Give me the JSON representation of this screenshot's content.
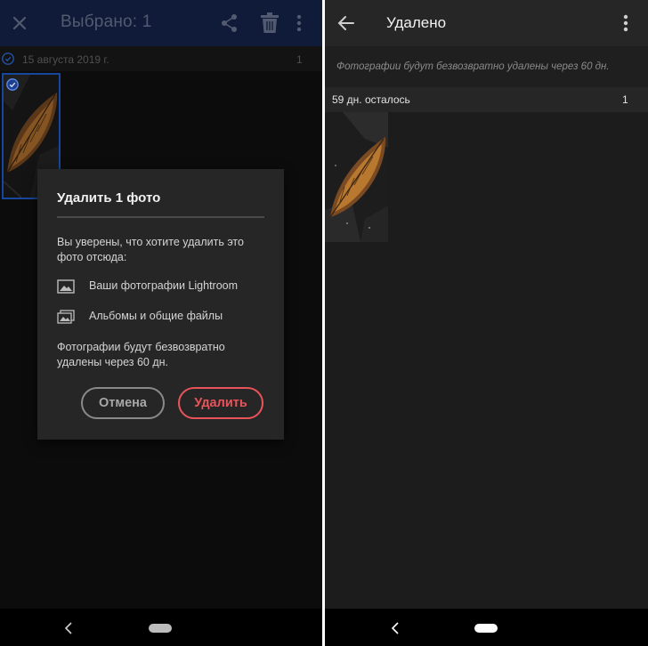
{
  "left_screen": {
    "selection_bar": {
      "title": "Выбрано: 1",
      "close_icon": "close-icon",
      "share_icon": "share-icon",
      "delete_icon": "trash-icon",
      "more_icon": "more-vertical-icon",
      "background": "#14254b"
    },
    "group": {
      "date": "15 августа 2019 г.",
      "count": "1",
      "selected": true
    },
    "dialog": {
      "title": "Удалить 1 фото",
      "question": "Вы уверены, что хотите удалить это фото отсюда:",
      "options": [
        {
          "icon": "image-icon",
          "label": "Ваши фотографии Lightroom"
        },
        {
          "icon": "albums-icon",
          "label": "Альбомы и общие файлы"
        }
      ],
      "note": "Фотографии будут безвозвратно удалены через 60 дн.",
      "cancel_label": "Отмена",
      "delete_label": "Удалить",
      "delete_color": "#e9545a"
    }
  },
  "right_screen": {
    "title": "Удалено",
    "back_icon": "arrow-left-icon",
    "more_icon": "more-vertical-icon",
    "info": "Фотографии будут безвозвратно удалены через 60 дн.",
    "group": {
      "label": "59 дн. осталось",
      "count": "1"
    }
  },
  "navigation_bar": {
    "back_icon": "chevron-left-icon",
    "home_icon": "home-pill-icon"
  },
  "colors": {
    "selection_accent": "#1f5fd1",
    "dialog_background": "#262626",
    "screen_background": "#111111"
  }
}
